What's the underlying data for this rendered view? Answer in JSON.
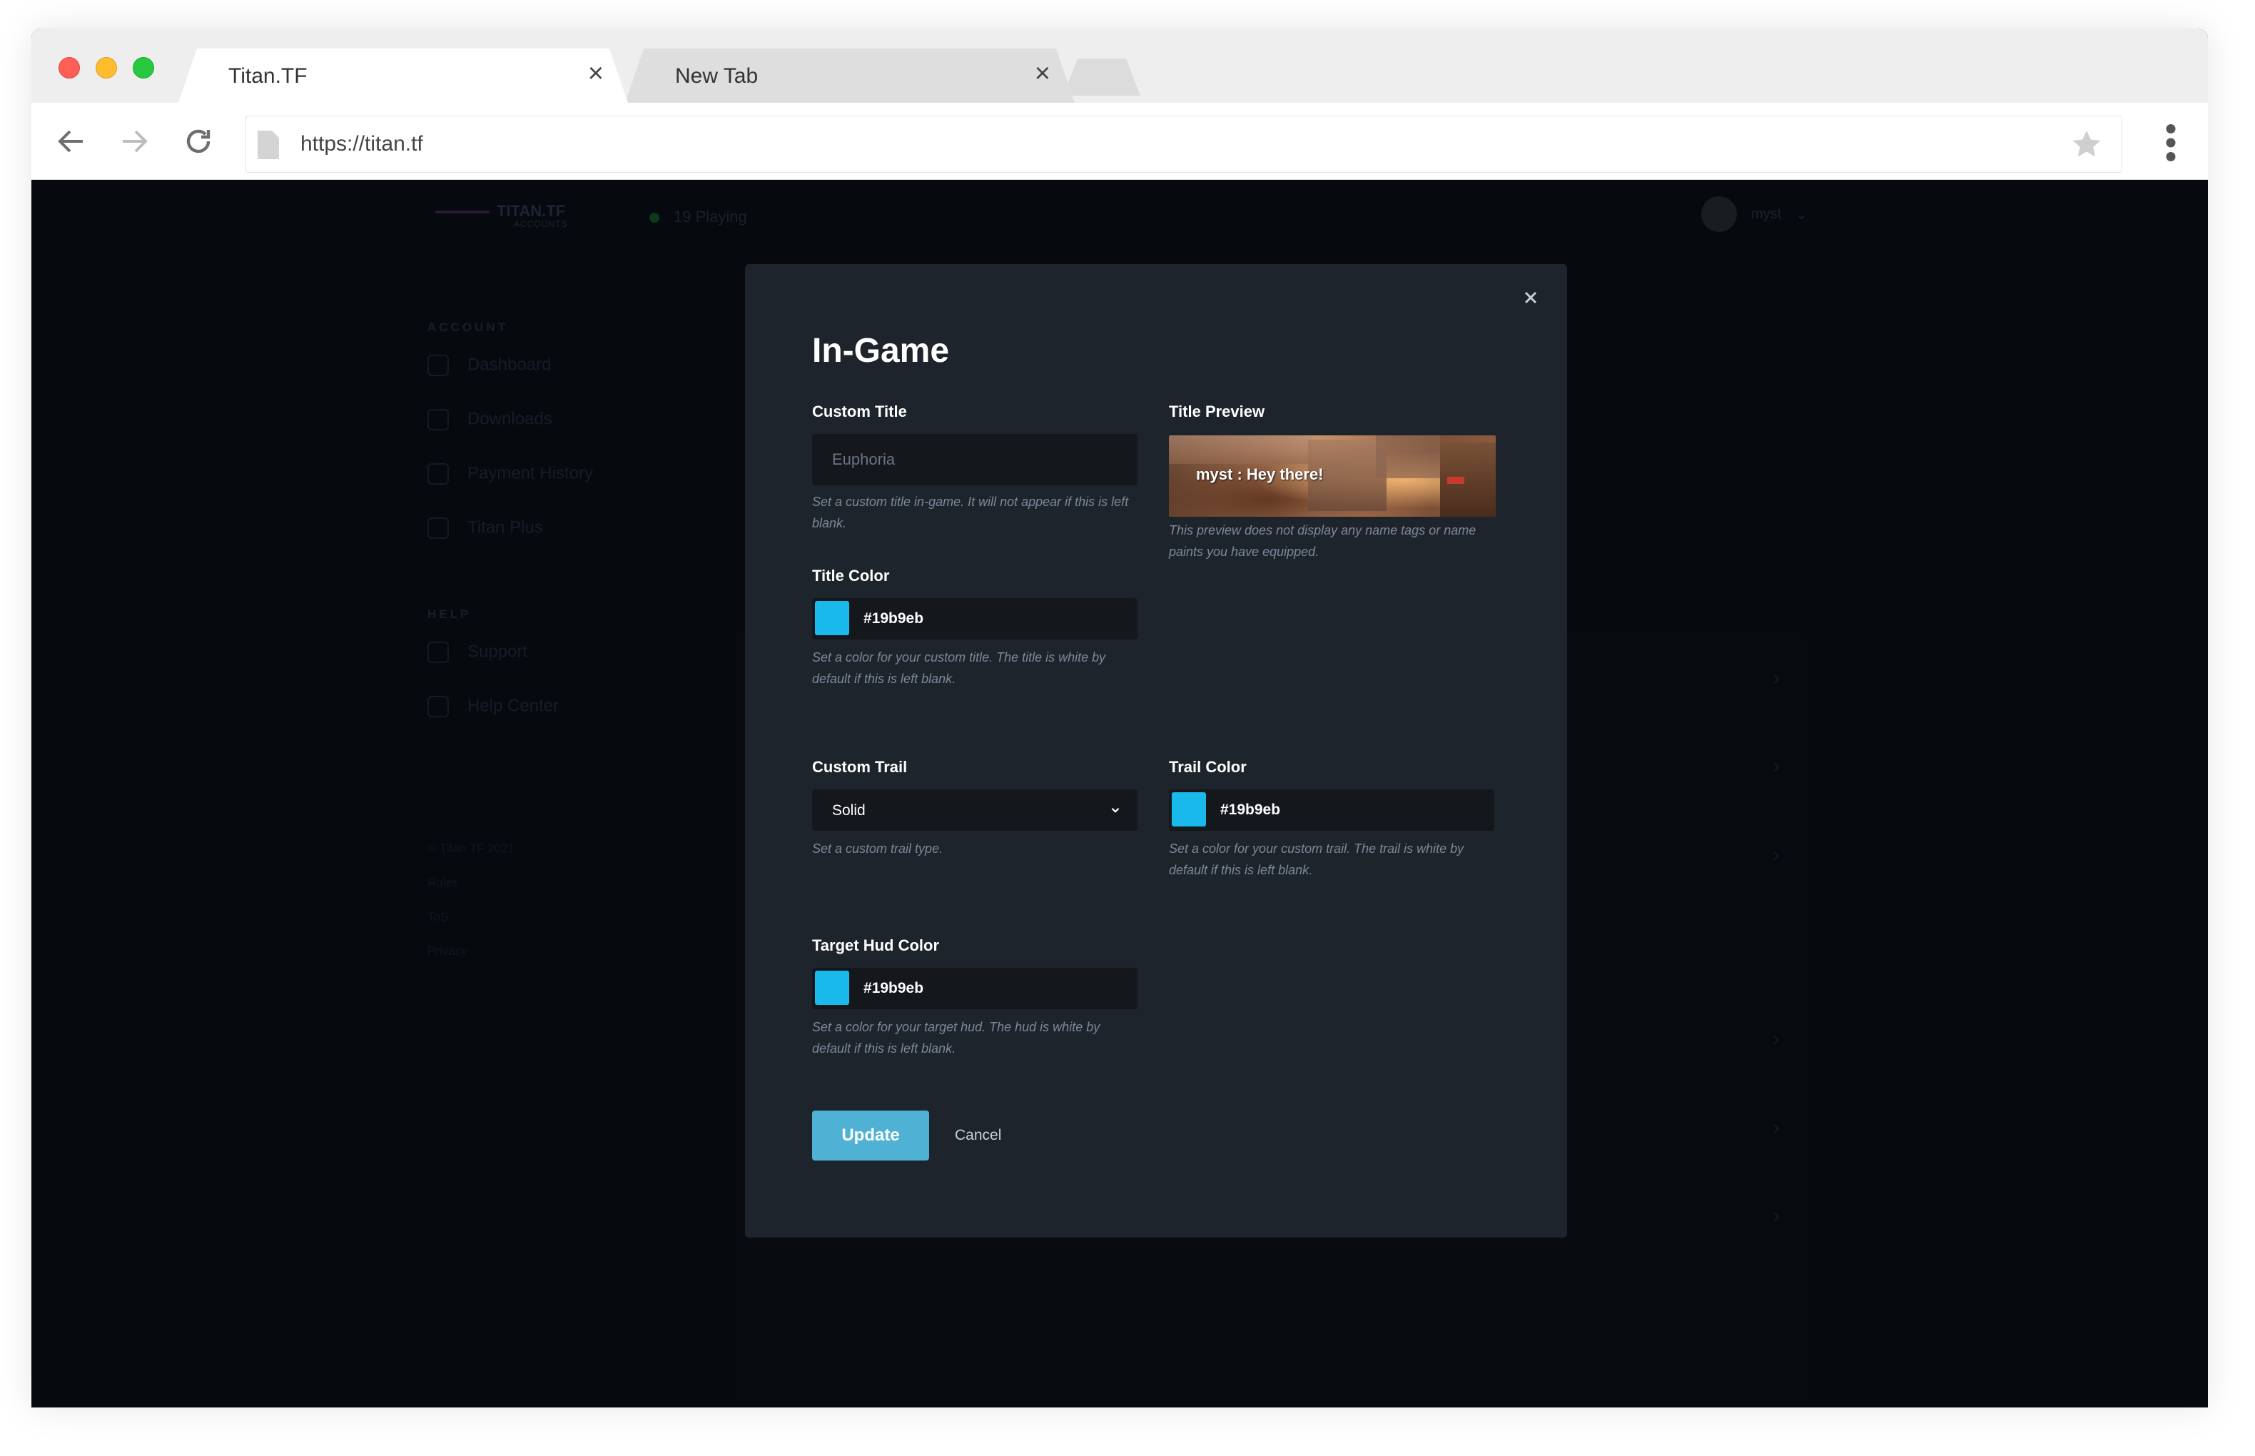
{
  "browser": {
    "tabs": [
      {
        "title": "Titan.TF",
        "active": true
      },
      {
        "title": "New Tab",
        "active": false
      }
    ],
    "url": "https://titan.tf"
  },
  "background": {
    "brand": "TITAN.TF",
    "brand_sub": "ACCOUNTS",
    "online_count": "19 Playing",
    "username": "myst",
    "account_section": "ACCOUNT",
    "account_items": [
      "Dashboard",
      "Downloads",
      "Payment History",
      "Titan Plus"
    ],
    "help_section": "HELP",
    "help_items": [
      "Support",
      "Help Center"
    ],
    "footer_copyright": "© Titan.TF 2021",
    "footer_links": [
      "Rules",
      "ToS",
      "Privacy"
    ]
  },
  "modal": {
    "title": "In-Game",
    "custom_title": {
      "label": "Custom Title",
      "placeholder": "Euphoria",
      "value": "",
      "hint": "Set a custom title in-game. It will not appear if this is left blank."
    },
    "title_preview": {
      "label": "Title Preview",
      "sample_text": "myst : Hey there!",
      "hint": "This preview does not display any name tags or name paints you have equipped."
    },
    "title_color": {
      "label": "Title Color",
      "value": "#19b9eb",
      "hint": "Set a color for your custom title. The title is white by default if this is left blank."
    },
    "custom_trail": {
      "label": "Custom Trail",
      "value": "Solid",
      "hint": "Set a custom trail type."
    },
    "trail_color": {
      "label": "Trail Color",
      "value": "#19b9eb",
      "hint": "Set a color for your custom trail. The trail is white by default if this is left blank."
    },
    "target_hud_color": {
      "label": "Target Hud Color",
      "value": "#19b9eb",
      "hint": "Set a color for your target hud. The hud is white by default if this is left blank."
    },
    "update_label": "Update",
    "cancel_label": "Cancel"
  },
  "colors": {
    "accent_button": "#4fb1d4",
    "swatch": "#19b9eb",
    "modal_bg": "#1e242c"
  }
}
